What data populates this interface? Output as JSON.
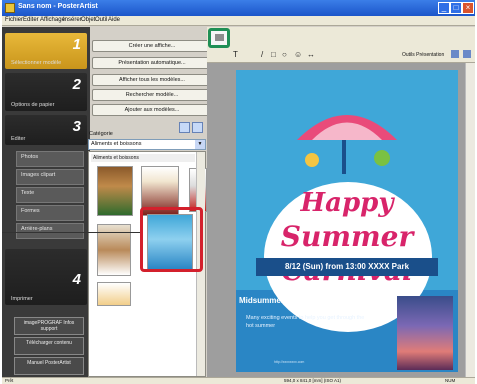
{
  "window": {
    "title": "Sans nom - PosterArtist",
    "controls": [
      "_",
      "□",
      "×"
    ]
  },
  "menu": [
    "Fichier",
    "Editer",
    "Affichage",
    "Insérer",
    "Objet",
    "Outil",
    "Aide"
  ],
  "steps": [
    {
      "num": "1",
      "label": "Sélectionner modèle"
    },
    {
      "num": "2",
      "label": "Options de papier"
    },
    {
      "num": "3",
      "label": "Editer"
    },
    {
      "num": "4",
      "label": "Imprimer"
    }
  ],
  "edit_subitems": [
    "Photos",
    "Images clipart",
    "Texte",
    "Formes",
    "Arrière-plans"
  ],
  "bottom_buttons": [
    "imagePROGRAF Infos support",
    "Télécharger contenu",
    "Manuel PosterArtist"
  ],
  "actions": [
    "Créer une affiche...",
    "Présentation automatique...",
    "Afficher tous les modèles...",
    "Rechercher modèle...",
    "Ajouter aux modèles..."
  ],
  "catalogue": {
    "label": "Catégorie",
    "selected": "Aliments et boissons",
    "group": "Aliments et boissons",
    "thumbs": [
      "menu",
      "steak house",
      "bbq",
      "food",
      "summer carnival",
      "fruit"
    ]
  },
  "toolbar": {
    "preview_label": "Outils Présentation",
    "tools": [
      "T",
      "/",
      "□",
      "○",
      "☺",
      "↔"
    ]
  },
  "poster": {
    "line1": "Happy",
    "line2": "Summer",
    "line3": "Carnival",
    "band": "8/12 (Sun) from 13:00  XXXX Park",
    "heading": "Midsummer outdoor carnival",
    "body": "Many exciting events to help you get through the hot summer",
    "url": "http://xxxxxxxx.com",
    "colors": {
      "sky": "#3fa7d8",
      "accent": "#d8246a",
      "band": "#1a4f8a"
    }
  },
  "status": {
    "left": "Prêt",
    "center": "594,0 x 841,0 [mm] (ISO A1)",
    "right": "NUM"
  },
  "highlight_colors": {
    "callout": "#d3202c",
    "toolbar_icon": "#1f8f55"
  }
}
